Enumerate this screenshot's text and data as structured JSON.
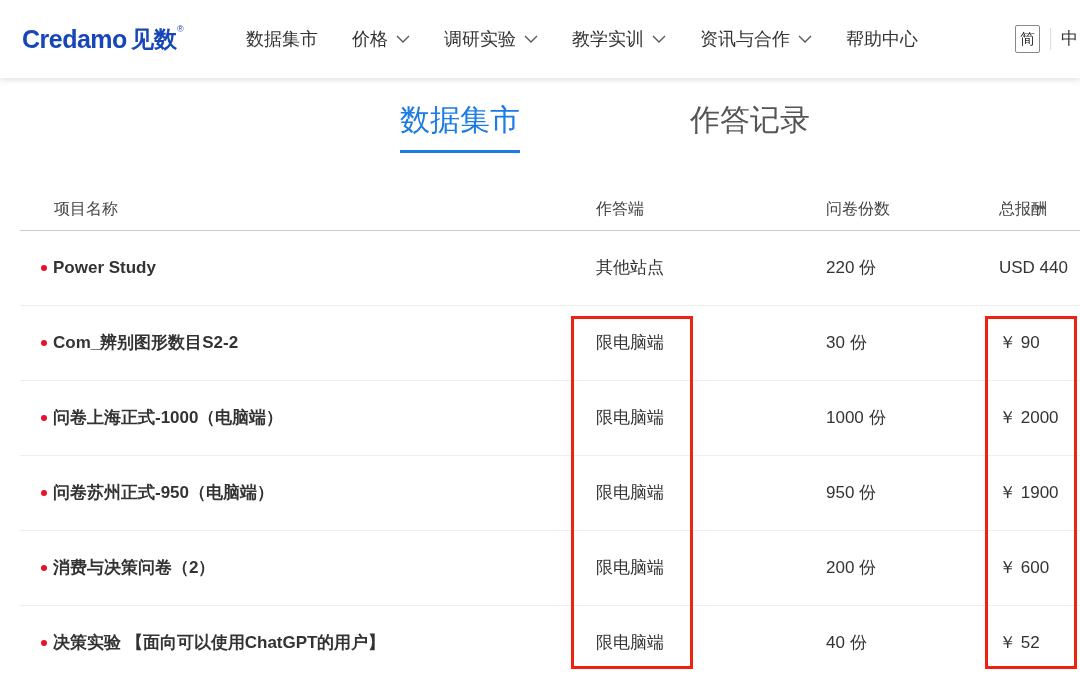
{
  "header": {
    "logo": {
      "wordmark": "Credamo",
      "chinese": "见数",
      "mark": "®"
    },
    "nav": [
      {
        "label": "数据集市",
        "dropdown": false
      },
      {
        "label": "价格",
        "dropdown": true
      },
      {
        "label": "调研实验",
        "dropdown": true
      },
      {
        "label": "教学实训",
        "dropdown": true
      },
      {
        "label": "资讯与合作",
        "dropdown": true
      },
      {
        "label": "帮助中心",
        "dropdown": false
      }
    ],
    "language": [
      {
        "label": "简",
        "selected": true
      },
      {
        "label": "中",
        "selected": false
      }
    ]
  },
  "tabs": [
    {
      "label": "数据集市",
      "selected": true
    },
    {
      "label": "作答记录",
      "selected": false
    }
  ],
  "table": {
    "columns": [
      {
        "label": "项目名称",
        "highlighted": false
      },
      {
        "label": "作答端",
        "highlighted": true
      },
      {
        "label": "问卷份数",
        "highlighted": false
      },
      {
        "label": "总报酬",
        "highlighted": true
      }
    ],
    "rows": [
      {
        "name": "Power Study",
        "device": "其他站点",
        "copies": "220 份",
        "reward": "USD 440",
        "highlighted": false
      },
      {
        "name": "Com_辨别图形数目S2-2",
        "device": "限电脑端",
        "copies": "30 份",
        "reward": "￥ 90",
        "highlighted": true
      },
      {
        "name": "问卷上海正式-1000（电脑端）",
        "device": "限电脑端",
        "copies": "1000 份",
        "reward": "￥ 2000",
        "highlighted": true
      },
      {
        "name": "问卷苏州正式-950（电脑端）",
        "device": "限电脑端",
        "copies": "950 份",
        "reward": "￥ 1900",
        "highlighted": true
      },
      {
        "name": "消费与决策问卷（2）",
        "device": "限电脑端",
        "copies": "200 份",
        "reward": "￥ 600",
        "highlighted": true
      },
      {
        "name": "决策实验 【面向可以使用ChatGPT的用户】",
        "device": "限电脑端",
        "copies": "40 份",
        "reward": "￥ 52",
        "highlighted": true
      }
    ]
  }
}
